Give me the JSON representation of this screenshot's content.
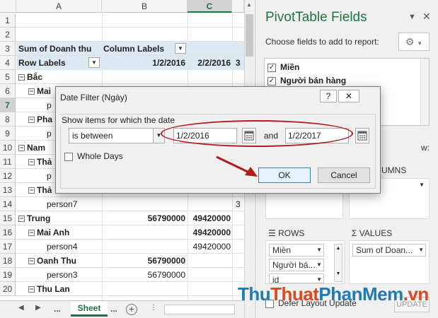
{
  "sheet": {
    "columns": [
      "A",
      "B",
      "C"
    ],
    "selected_column": "C",
    "rows": [
      "1",
      "2",
      "3",
      "4",
      "5",
      "6",
      "7",
      "8",
      "9",
      "10",
      "11",
      "12",
      "13",
      "14",
      "15",
      "16",
      "17",
      "18",
      "19",
      "20"
    ],
    "selected_row": "7",
    "cells": {
      "r3a": "Sum of Doanh thu",
      "r3b": "Column Labels",
      "r4a": "Row Labels",
      "r4b": "1/2/2016",
      "r4c": "2/2/2016",
      "r4d": "3",
      "r5a": "Bắc",
      "r6a": "Mai",
      "r7a": "p",
      "r8a": "Pha",
      "r9a": "p",
      "r10a": "Nam",
      "r11a": "Thả",
      "r12a": "p",
      "r13a": "Thả",
      "r14a": "person7",
      "r14d": "3",
      "r15a": "Trung",
      "r15b": "56790000",
      "r15c": "49420000",
      "r16a": "Mai Anh",
      "r16c": "49420000",
      "r17a": "person4",
      "r17c": "49420000",
      "r18a": "Oanh Thu",
      "r18b": "56790000",
      "r19a": "person3",
      "r19b": "56790000",
      "r20a": "Thu Lan"
    },
    "tabs": {
      "ellipsis_left": "...",
      "sheet_name": "Sheet",
      "ellipsis_right": "...",
      "add": "+"
    }
  },
  "pane": {
    "title": "PivotTable Fields",
    "subtitle": "Choose fields to add to report:",
    "fields": [
      {
        "label": "Miền",
        "checked": true
      },
      {
        "label": "Người bán hàng",
        "checked": true
      }
    ],
    "filters_label_fragment": "w:",
    "columns_label_fragment": "UMNS",
    "rows_label": "ROWS",
    "values_label": "VALUES",
    "row_fields": [
      "Miền",
      "Người bá...",
      "id"
    ],
    "value_fields": [
      "Sum of Doan..."
    ],
    "defer_label": "Defer Layout Update",
    "update_label": "UPDATE"
  },
  "dialog": {
    "title": "Date Filter (Ngày)",
    "help": "?",
    "close": "✕",
    "group_label": "Show items for which the date",
    "operator": "is between",
    "value_from": "1/2/2016",
    "and_label": "and",
    "value_to": "1/2/2017",
    "whole_days_label": "Whole Days",
    "ok_label": "OK",
    "cancel_label": "Cancel"
  },
  "watermark": {
    "part1": "Thu",
    "part2": "Thuat",
    "part3": "PhanMem",
    "part4": ".vn"
  },
  "colors": {
    "excel_green": "#217346",
    "annotation_red": "#b31b1b",
    "header_band": "#dde8f3"
  }
}
